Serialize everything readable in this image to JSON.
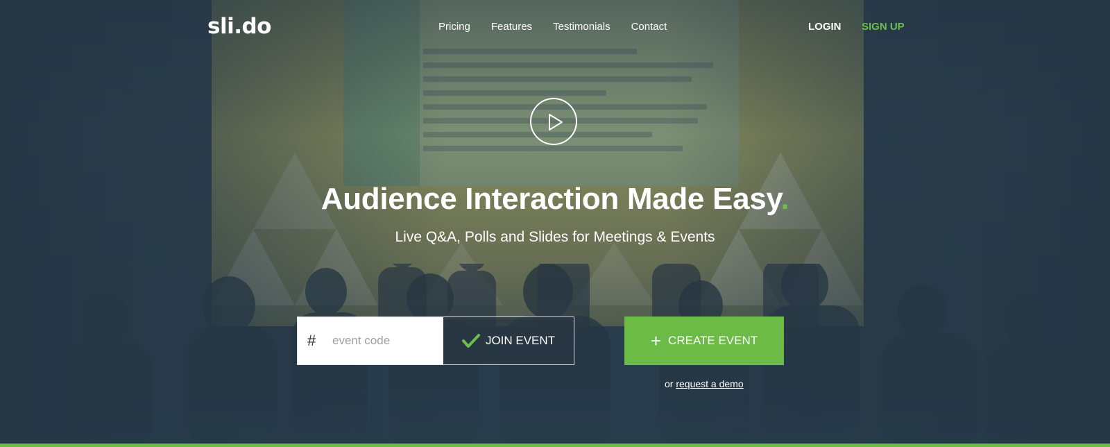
{
  "brand": {
    "logo_text": "sli.do",
    "accent_color": "#6cbb47"
  },
  "nav": {
    "links": [
      "Pricing",
      "Features",
      "Testimonials",
      "Contact"
    ],
    "login_label": "LOGIN",
    "signup_label": "SIGN UP"
  },
  "hero": {
    "headline": "Audience Interaction Made Easy",
    "headline_dot": ".",
    "subheadline": "Live Q&A, Polls and Slides for Meetings & Events"
  },
  "join": {
    "hash_symbol": "#",
    "placeholder": "event code",
    "button_label": "JOIN EVENT",
    "icon": "checkmark-icon"
  },
  "create": {
    "button_label": "CREATE EVENT",
    "icon": "plus-icon",
    "demo_prefix": "or",
    "demo_link": "request a demo"
  },
  "video": {
    "icon": "play-icon"
  }
}
